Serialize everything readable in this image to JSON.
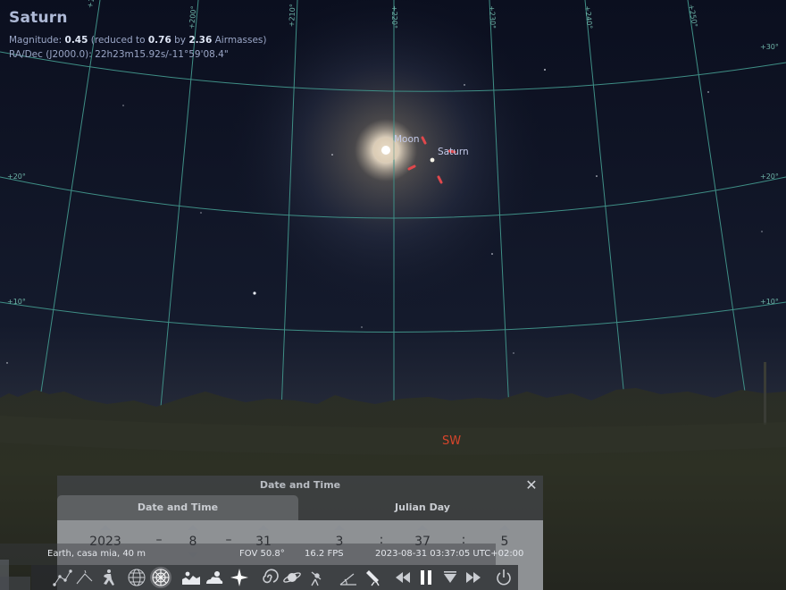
{
  "app": "Stellarium",
  "object_info": {
    "name": "Saturn",
    "magnitude_label": "Magnitude: ",
    "magnitude_value": "0.45",
    "reduced_prefix": " (reduced to ",
    "reduced_value": "0.76",
    "by_text": " by ",
    "airmass_value": "2.36",
    "airmass_suffix": " Airmasses)",
    "radec": "RA/Dec (J2000.0): 22h23m15.92s/-11°59'08.4\""
  },
  "sky_labels": {
    "moon": "Moon",
    "saturn": "Saturn"
  },
  "grid_labels": {
    "ra": [
      "+190°",
      "+200°",
      "+210°",
      "+220°",
      "+230°",
      "+240°",
      "+250°"
    ],
    "dec_left": [
      "+20°",
      "+10°"
    ],
    "dec_right": [
      "+30°",
      "+20°",
      "+10°"
    ]
  },
  "cardinal": "SW",
  "dialog": {
    "title": "Date and Time",
    "close_icon": "close-icon",
    "tab_date": "Date and Time",
    "tab_jd": "Julian Day",
    "year": "2023",
    "month": "8",
    "day": "31",
    "hour": "3",
    "minute": "37",
    "second": "5",
    "date_sep": "–",
    "time_sep": ":"
  },
  "status": {
    "location": "Earth, casa mia, 40 m",
    "fov": "FOV 50.8°",
    "fps": "16.2 FPS",
    "datetime": "2023-08-31 03:37:05 UTC+02:00"
  },
  "toolbar_icons": [
    "constellation-lines-icon",
    "constellation-labels-icon",
    "constellation-art-icon",
    "equatorial-grid-icon",
    "azimuthal-grid-icon",
    "ground-icon",
    "atmosphere-icon",
    "cardinal-points-icon",
    "nebulae-icon",
    "planet-labels-icon",
    "equatorial-mount-icon",
    "goto-icon",
    "night-mode-icon",
    "rewind-icon",
    "pause-icon",
    "realtime-icon",
    "forward-icon",
    "quit-icon"
  ],
  "colors": {
    "grid": "#3f8f86",
    "label": "#c3c9e8",
    "cardinal": "#d8452b",
    "pointer": "#e0484c"
  }
}
